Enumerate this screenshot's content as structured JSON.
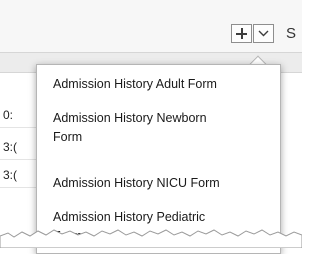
{
  "toolbar": {
    "add_icon": "plus-icon",
    "expand_icon": "chevron-down-icon",
    "cut_off_label": "S"
  },
  "grid": {
    "visible_cells": [
      "0:",
      "3:(",
      "3:("
    ]
  },
  "menu": {
    "items": [
      "Admission History Adult Form",
      "Admission History Newborn Form",
      "Admission History NICU Form",
      "Admission History Pediatric Form"
    ]
  }
}
